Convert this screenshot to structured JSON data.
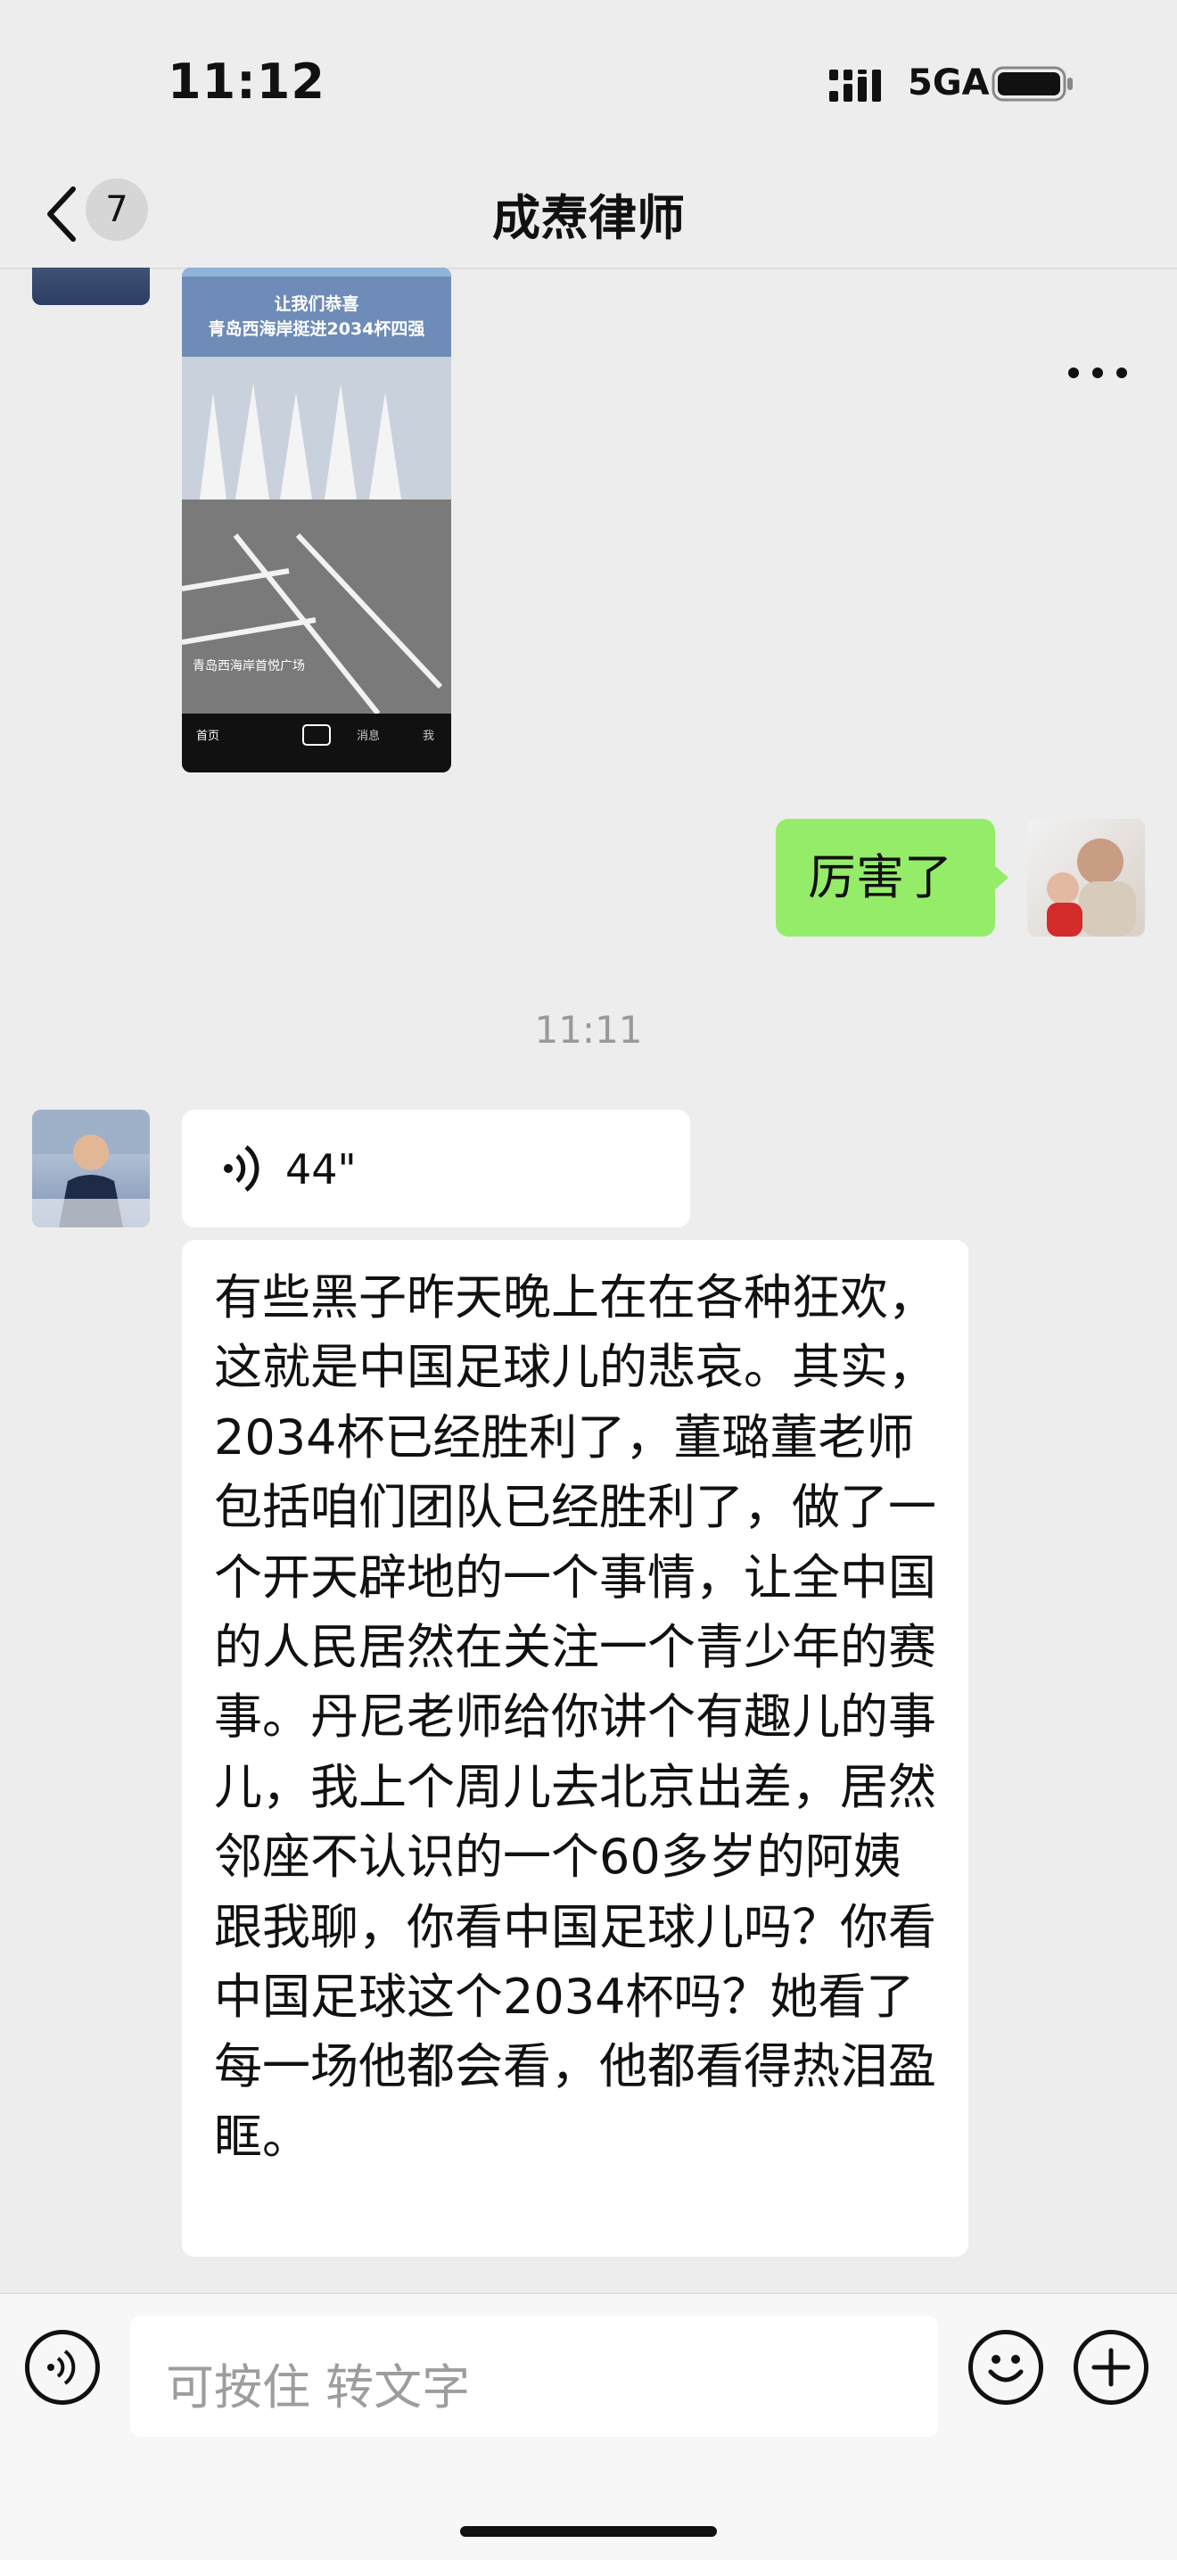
{
  "status": {
    "time": "11:12",
    "network": "5GA"
  },
  "nav": {
    "unread_count": "7",
    "title": "成焘律师"
  },
  "chat": {
    "shared_image": {
      "banner_line1": "让我们恭喜",
      "banner_line2": "青岛西海岸挺进2034杯四强",
      "location_text": "青岛西海岸首悦广场",
      "tabs": [
        "首页",
        "消息",
        "我"
      ]
    },
    "my_message": "厉害了",
    "timestamp": "11:11",
    "voice": {
      "duration": "44\""
    },
    "transcript": "有些黑子昨天晚上在在各种狂欢，这就是中国足球儿的悲哀。其实，2034杯已经胜利了，董璐董老师包括咱们团队已经胜利了，做了一个开天辟地的一个事情，让全中国的人民居然在关注一个青少年的赛事。丹尼老师给你讲个有趣儿的事儿，我上个周儿去北京出差，居然邻座不认识的一个60多岁的阿姨跟我聊，你看中国足球儿吗？你看中国足球这个2034杯吗？她看了每一场他都会看，他都看得热泪盈眶。"
  },
  "input": {
    "placeholder": "可按住 转文字"
  },
  "colors": {
    "my_bubble": "#95ec69",
    "background": "#ededed"
  }
}
